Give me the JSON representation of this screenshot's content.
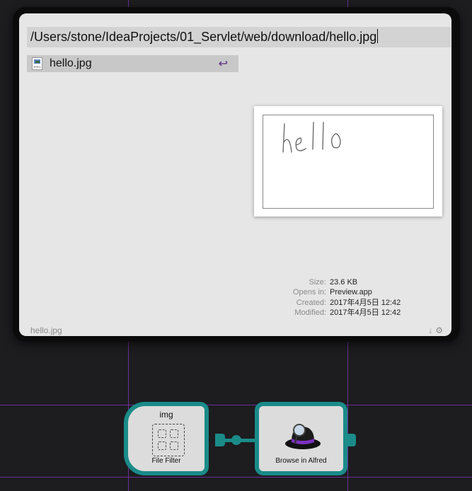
{
  "alfred": {
    "query": "/Users/stone/IdeaProjects/01_Servlet/web/download/hello.jpg",
    "result": {
      "title": "hello.jpg",
      "icon": "jpeg-file-icon",
      "action_glyph": "↩"
    },
    "preview": {
      "handwriting": "hello"
    },
    "metadata": [
      {
        "label": "Size:",
        "value": "23.6 KB"
      },
      {
        "label": "Opens in:",
        "value": "Preview.app"
      },
      {
        "label": "Created:",
        "value": "2017年4月5日 12:42"
      },
      {
        "label": "Modified:",
        "value": "2017年4月5日 12:42"
      }
    ],
    "footer": {
      "filename": "hello.jpg",
      "sort_glyph": "↓",
      "settings_glyph": "⚙"
    }
  },
  "workflow": {
    "file_filter": {
      "keyword": "img",
      "title": "File Filter",
      "icon": "file-filter-icon"
    },
    "browse": {
      "title": "Browse in Alfred",
      "icon": "alfred-hat-icon"
    }
  },
  "colors": {
    "canvas": "#1d1c1f",
    "grid_line": "#6a2f9a",
    "node_border": "#1a8b89",
    "node_fill": "#dcdcdc",
    "panel": "#e6e6e6",
    "query_bg": "#d3d3d3",
    "selection": "#c8c8c8",
    "hat_band": "#7b2fbf"
  }
}
